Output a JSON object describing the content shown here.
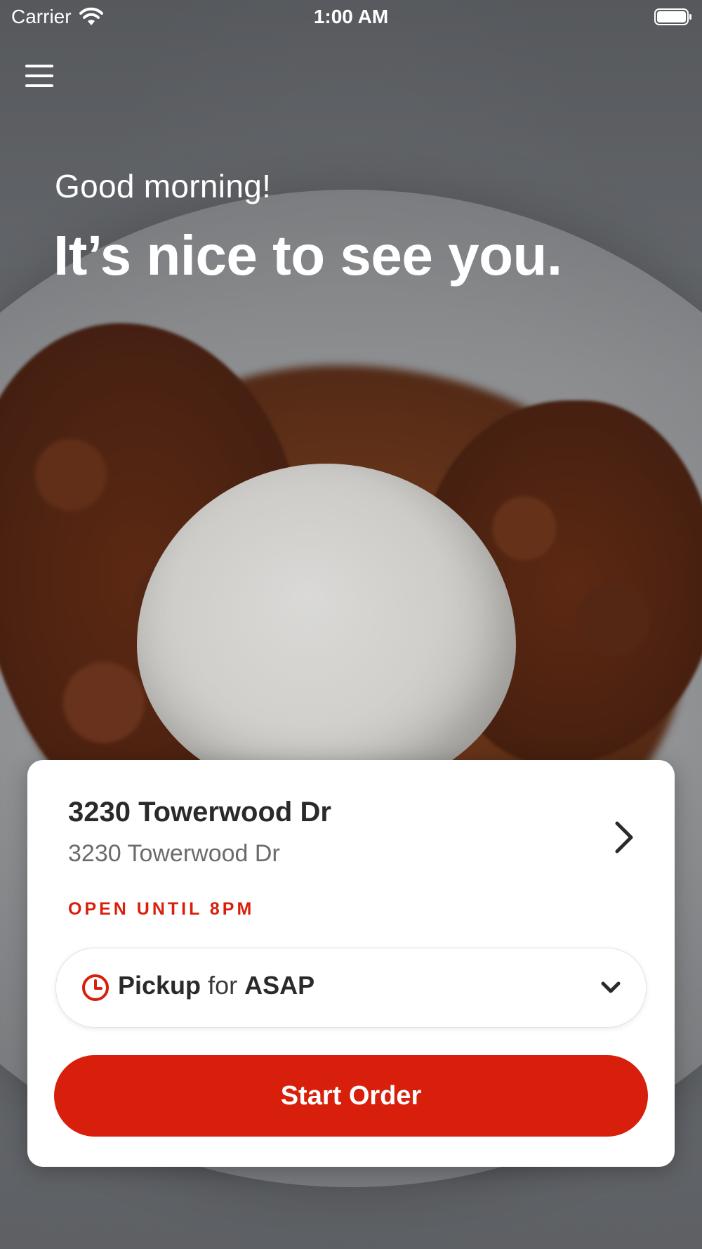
{
  "status_bar": {
    "carrier": "Carrier",
    "time": "1:00 AM"
  },
  "header": {
    "menu_icon": "hamburger-menu-icon"
  },
  "greeting": {
    "salutation": "Good morning!",
    "headline": "It’s nice to see you."
  },
  "location_card": {
    "name": "3230 Towerwood Dr",
    "address": "3230 Towerwood Dr",
    "hours": "OPEN UNTIL 8PM",
    "order_type": {
      "mode": "Pickup",
      "connector": "for",
      "time": "ASAP"
    },
    "start_button": "Start Order"
  },
  "colors": {
    "accent": "#d81f0c",
    "card_background": "#ffffff",
    "text_primary": "#2a2a2a",
    "text_secondary": "#6b6b6b"
  }
}
